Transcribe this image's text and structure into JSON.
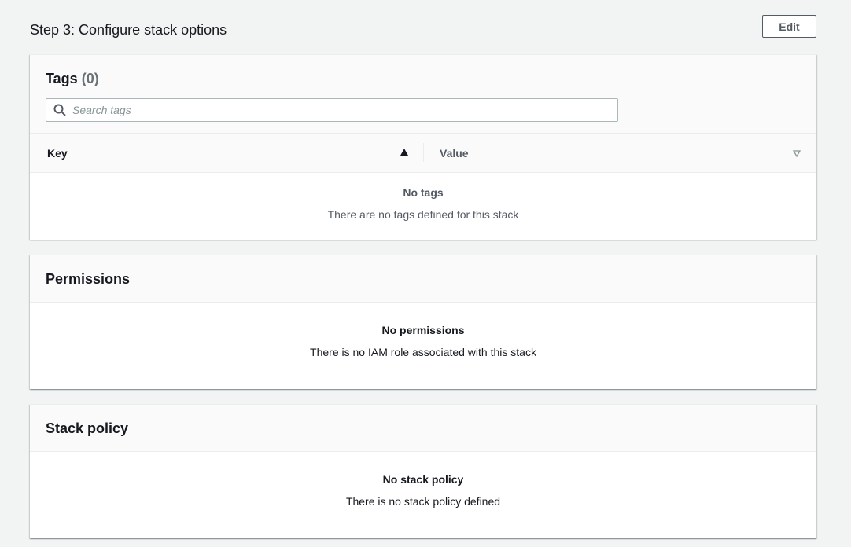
{
  "header": {
    "title": "Step 3: Configure stack options",
    "edit_label": "Edit"
  },
  "tags": {
    "title": "Tags",
    "count": "(0)",
    "search_placeholder": "Search tags",
    "search_value": "",
    "columns": {
      "key": "Key",
      "value": "Value"
    },
    "empty_title": "No tags",
    "empty_desc": "There are no tags defined for this stack"
  },
  "permissions": {
    "title": "Permissions",
    "empty_title": "No permissions",
    "empty_desc": "There is no IAM role associated with this stack"
  },
  "stack_policy": {
    "title": "Stack policy",
    "empty_title": "No stack policy",
    "empty_desc": "There is no stack policy defined"
  },
  "icons": {
    "search": "search-icon",
    "sort_ascending": "sort-ascending-icon",
    "sort_descending": "sort-descending-icon"
  },
  "colors": {
    "page_background": "#f2f3f3",
    "panel_header_background": "#fafafa",
    "text": "#16191f",
    "muted_text": "#545b64",
    "border": "#aab7b8"
  }
}
